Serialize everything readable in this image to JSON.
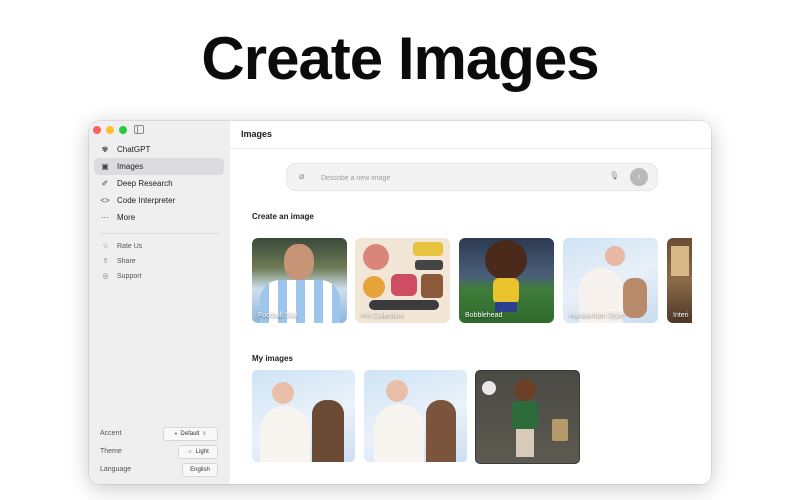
{
  "headline": "Create Images",
  "window": {
    "sidebar": {
      "nav": [
        {
          "label": "ChatGPT",
          "icon": "openai-logo-icon"
        },
        {
          "label": "Images",
          "icon": "image-icon",
          "active": true
        },
        {
          "label": "Deep Research",
          "icon": "telescope-icon"
        },
        {
          "label": "Code Interpreter",
          "icon": "code-icon"
        },
        {
          "label": "More",
          "icon": "ellipsis-icon"
        }
      ],
      "secondary": [
        {
          "label": "Rate Us",
          "icon": "star-icon"
        },
        {
          "label": "Share",
          "icon": "share-icon"
        },
        {
          "label": "Support",
          "icon": "support-icon"
        }
      ],
      "settings": {
        "accent_label": "Accent",
        "accent_value": "Default",
        "theme_label": "Theme",
        "theme_value": "Light",
        "language_label": "Language",
        "language_value": "English"
      }
    },
    "main": {
      "title": "Images",
      "prompt_placeholder": "Describe a new image",
      "create_title": "Create an image",
      "templates": [
        "Football Star",
        "Pin Collection",
        "Bobblehead",
        "Handwritten Style",
        "Interi"
      ],
      "my_images_title": "My images"
    }
  },
  "colors": {
    "traffic_red": "#ff5f57",
    "traffic_yellow": "#febc2e",
    "traffic_green": "#28c840",
    "sidebar_bg": "#efeff0",
    "active_item": "#dcdcde"
  }
}
